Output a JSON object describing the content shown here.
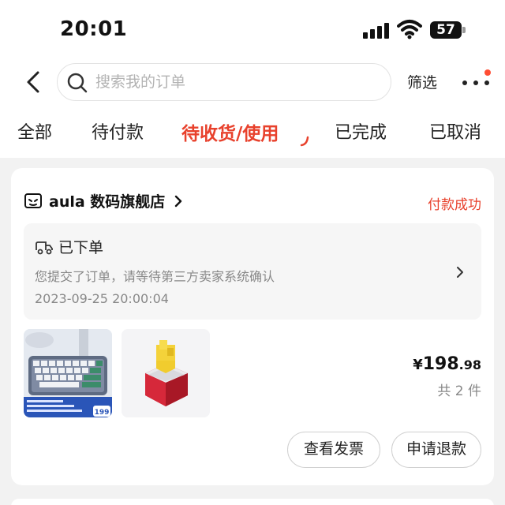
{
  "status_bar": {
    "time": "20:01",
    "battery": "57"
  },
  "header": {
    "search": {
      "placeholder": "搜索我的订单"
    },
    "filter_label": "筛选"
  },
  "tabs": [
    {
      "label": "全部",
      "active": false
    },
    {
      "label": "待付款",
      "active": false
    },
    {
      "label": "待收货/使用",
      "active": true
    },
    {
      "label": "已完成",
      "active": false
    },
    {
      "label": "已取消",
      "active": false
    }
  ],
  "order": {
    "store_name": "aula 数码旗舰店",
    "status": "付款成功",
    "notice": {
      "title": "已下单",
      "description": "您提交了订单，请等待第三方卖家系统确认",
      "timestamp": "2023-09-25 20:00:04"
    },
    "price": {
      "currency": "¥",
      "integer": "198",
      "decimal": ".98"
    },
    "quantity_text": "共 2 件",
    "product_badge": "199",
    "actions": {
      "invoice_label": "查看发票",
      "refund_label": "申请退款"
    }
  },
  "colors": {
    "accent": "#e8412c",
    "background": "#f2f2f2"
  },
  "icons": [
    "back-icon",
    "search-icon",
    "more-icon",
    "store-icon",
    "truck-icon",
    "chevron-right-icon"
  ]
}
